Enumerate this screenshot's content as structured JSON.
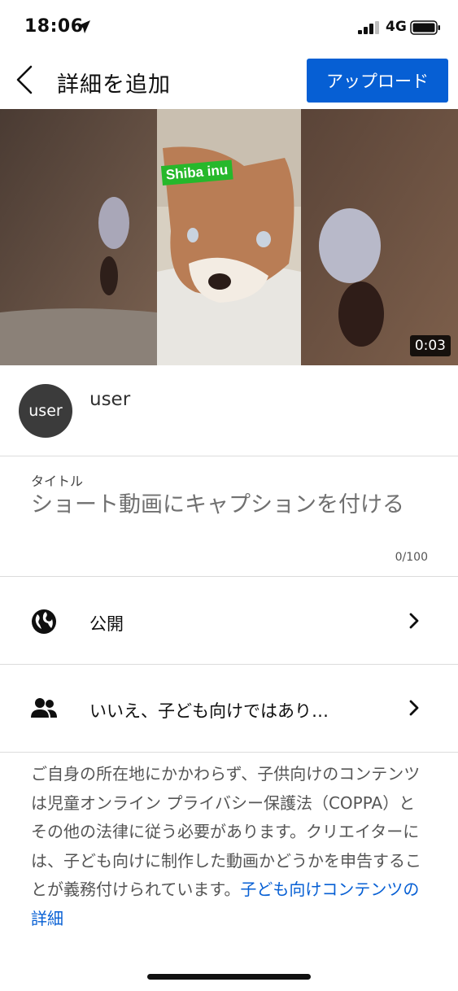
{
  "status_bar": {
    "time": "18:06",
    "network": "4G",
    "icons": [
      "location-arrow-icon",
      "signal-bars-icon",
      "battery-icon"
    ]
  },
  "header": {
    "title": "詳細を追加",
    "upload_label": "アップロード",
    "back_icon": "back-chevron-icon",
    "accent": "#065fd4"
  },
  "video": {
    "sticker_text": "Shiba inu",
    "duration": "0:03",
    "sticker_color": "#26b82b"
  },
  "user": {
    "avatar_text": "user",
    "name": "user"
  },
  "title_field": {
    "label": "タイトル",
    "value": "ショート動画にキャプションを付ける",
    "char_count": "0/100"
  },
  "options": [
    {
      "icon": "globe-icon",
      "label": "公開"
    },
    {
      "icon": "people-icon",
      "label": "いいえ、子ども向けではあり…"
    }
  ],
  "disclaimer": {
    "text": "ご自身の所在地にかかわらず、子供向けのコンテンツは児童オンライン プライバシー保護法（COPPA）とその他の法律に従う必要があります。クリエイターには、子ども向けに制作した動画かどうかを申告することが義務付けられています。",
    "link_text": "子ども向けコンテンツの詳細",
    "link_color": "#065fd4"
  }
}
